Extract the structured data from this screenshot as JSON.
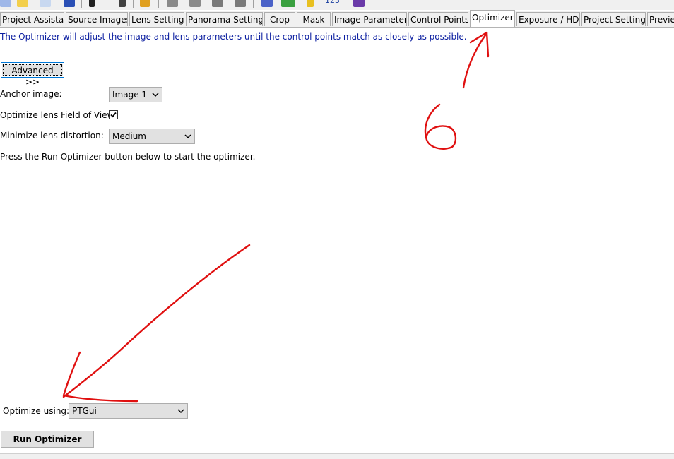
{
  "toolbar": {
    "counter_text": "123"
  },
  "tabs": [
    {
      "label": "Project Assistant",
      "active": false
    },
    {
      "label": "Source Images",
      "active": false
    },
    {
      "label": "Lens Settings",
      "active": false
    },
    {
      "label": "Panorama Settings",
      "active": false
    },
    {
      "label": "Crop",
      "active": false
    },
    {
      "label": "Mask",
      "active": false
    },
    {
      "label": "Image Parameters",
      "active": false
    },
    {
      "label": "Control Points",
      "active": false
    },
    {
      "label": "Optimizer",
      "active": true
    },
    {
      "label": "Exposure / HDR",
      "active": false
    },
    {
      "label": "Project Settings",
      "active": false
    },
    {
      "label": "Previe",
      "active": false
    }
  ],
  "optimizer": {
    "description": "The Optimizer will adjust the image and lens parameters until the control points match as closely as possible.",
    "advanced_label": "Advanced >>",
    "anchor_label": "Anchor image:",
    "anchor_value": "Image 1",
    "fov_label": "Optimize lens Field of View:",
    "fov_checked": true,
    "distortion_label": "Minimize lens distortion:",
    "distortion_value": "Medium",
    "instructions": "Press the Run Optimizer button below to start the optimizer.",
    "optimize_using_label": "Optimize using:",
    "optimize_using_value": "PTGui",
    "run_label": "Run Optimizer"
  },
  "annotations": {
    "step_number": "6",
    "ink_color": "#e01010"
  }
}
